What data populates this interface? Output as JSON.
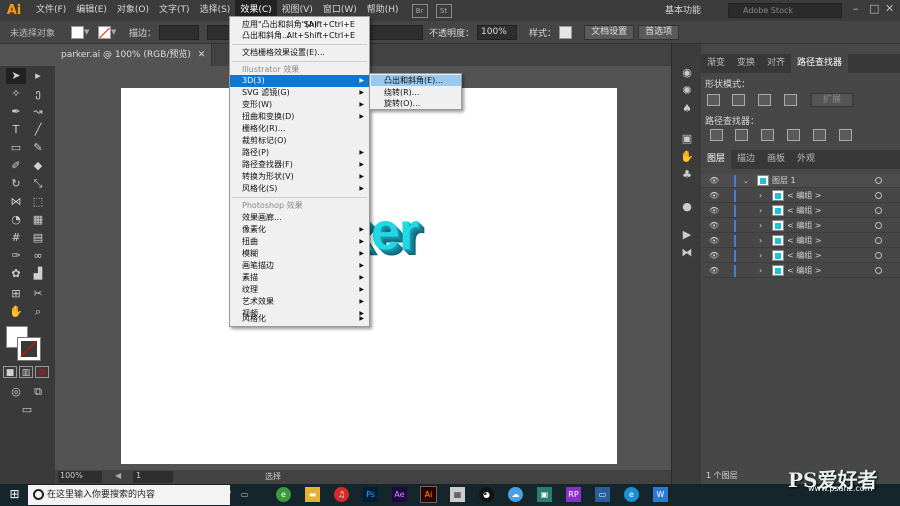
{
  "app": {
    "logo": "Ai",
    "doc_tab": "parker.ai @ 100% (RGB/预览)",
    "close": "✕"
  },
  "menubar": {
    "items": [
      "文件(F)",
      "编辑(E)",
      "对象(O)",
      "文字(T)",
      "选择(S)",
      "效果(C)",
      "视图(V)",
      "窗口(W)",
      "帮助(H)"
    ],
    "icons": [
      "Br",
      "St"
    ],
    "workspace": "基本功能",
    "stock_placeholder": "Adobe Stock"
  },
  "options": {
    "no_selection": "未选择对象",
    "stroke_label": "描边：",
    "opacity_label": "不透明度：",
    "opacity_value": "100%",
    "style_label": "样式：",
    "doc_settings": "文档设置",
    "preferences": "首选项"
  },
  "effect_menu": {
    "items": [
      {
        "label": "应用\"凸出和斜角\"(A)",
        "shortcut": "Shift+Ctrl+E"
      },
      {
        "label": "凸出和斜角...",
        "shortcut": "Alt+Shift+Ctrl+E"
      },
      {
        "label": "文档栅格效果设置(E)..."
      },
      {
        "label": "Illustrator 效果"
      },
      {
        "label": "3D(3)"
      },
      {
        "label": "SVG 滤镜(G)"
      },
      {
        "label": "变形(W)"
      },
      {
        "label": "扭曲和变换(D)"
      },
      {
        "label": "栅格化(R)..."
      },
      {
        "label": "裁剪标记(O)"
      },
      {
        "label": "路径(P)"
      },
      {
        "label": "路径查找器(F)"
      },
      {
        "label": "转换为形状(V)"
      },
      {
        "label": "风格化(S)"
      },
      {
        "label": "Photoshop 效果"
      },
      {
        "label": "效果画廊..."
      },
      {
        "label": "像素化"
      },
      {
        "label": "扭曲"
      },
      {
        "label": "模糊"
      },
      {
        "label": "画笔描边"
      },
      {
        "label": "素描"
      },
      {
        "label": "纹理"
      },
      {
        "label": "艺术效果"
      },
      {
        "label": "视频"
      },
      {
        "label": "风格化"
      }
    ]
  },
  "submenu_3d": {
    "items": [
      "凸出和斜角(E)...",
      "绕转(R)...",
      "旋转(O)..."
    ]
  },
  "artwork": {
    "text": "ker"
  },
  "status": {
    "zoom": "100%",
    "page": "1",
    "mode": "选择"
  },
  "right_panel": {
    "tabs1": [
      "渐变",
      "变换",
      "对齐",
      "路径查找器"
    ],
    "shape_modes": "形状模式：",
    "expand": "扩展",
    "pathfinders": "路径查找器：",
    "tabs2": [
      "图层",
      "描边",
      "画板",
      "外观"
    ],
    "layer_name": "图层 1",
    "sublayers": [
      "< 编组 >",
      "< 编组 >",
      "< 编组 >",
      "< 编组 >",
      "< 编组 >",
      "< 编组 >"
    ],
    "footer": "1 个图层"
  },
  "taskbar": {
    "search_placeholder": "在这里输入你要搜索的内容"
  },
  "watermark": {
    "main": "PS爱好者",
    "sub": "www.psahz.com"
  }
}
